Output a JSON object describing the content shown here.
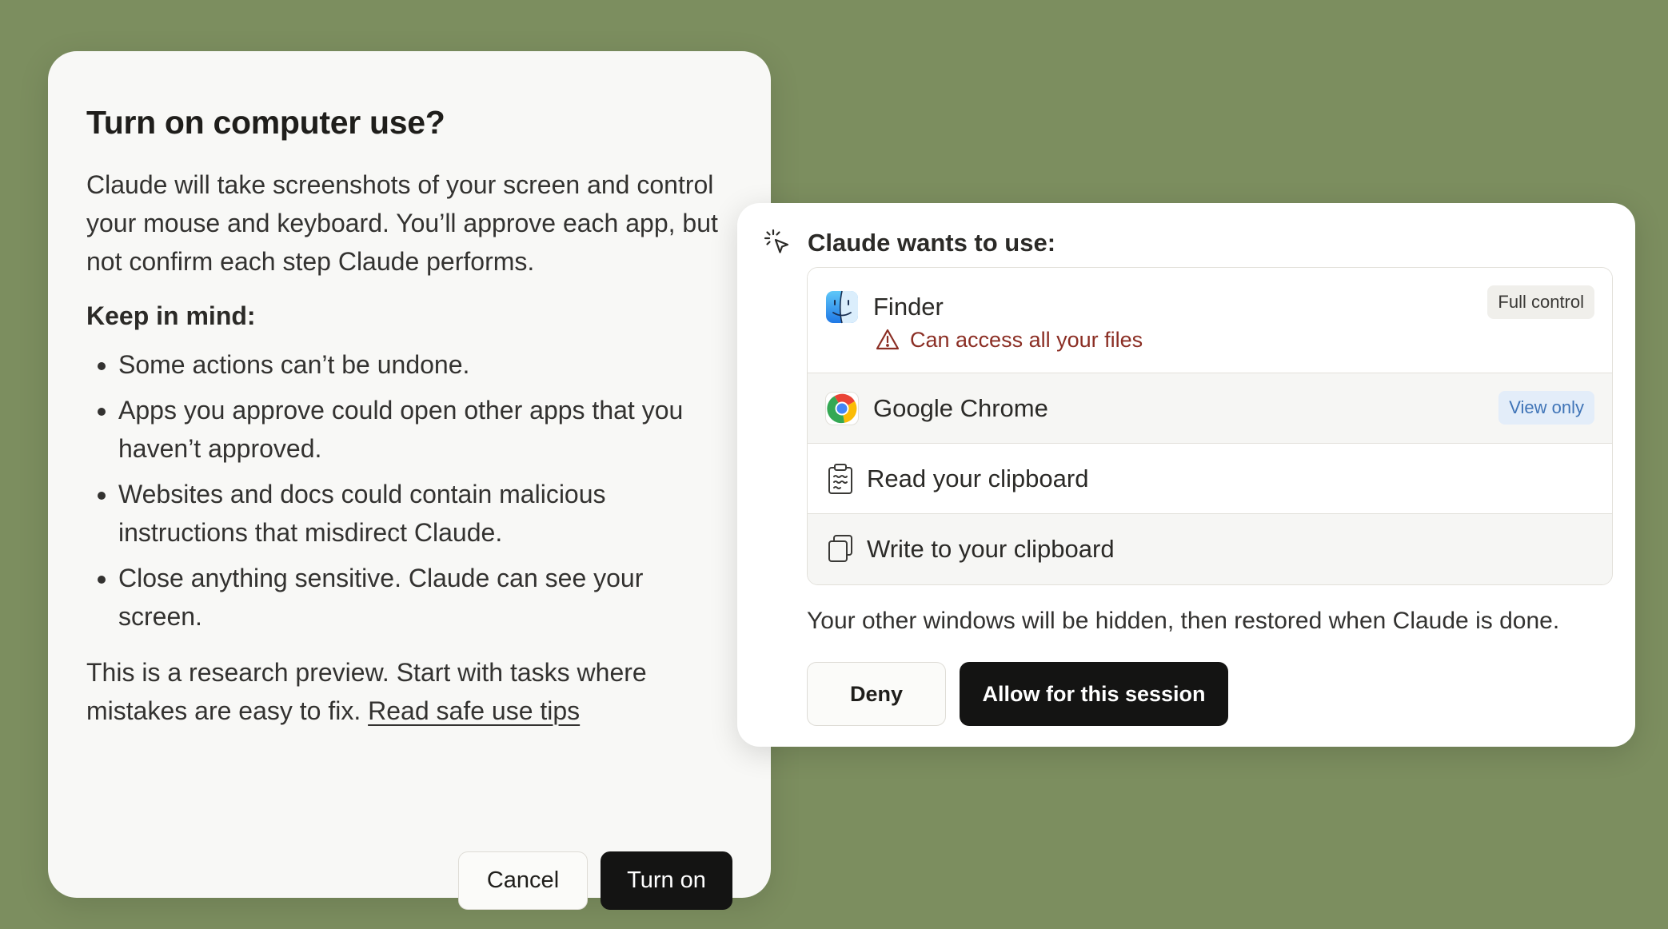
{
  "dialog": {
    "title": "Turn on computer use?",
    "intro": "Claude will take screenshots of your screen and control your mouse and keyboard. You’ll approve each app, but not confirm each step Claude performs.",
    "keep_in_mind_heading": "Keep in mind:",
    "bullets": [
      "Some actions can’t be undone.",
      "Apps you approve could open other apps that you haven’t approved.",
      "Websites and docs could contain malicious instructions that misdirect Claude.",
      "Close anything sensitive. Claude can see your screen."
    ],
    "note_text": "This is a research preview. Start with tasks where mistakes are easy to fix.",
    "note_link": "Read safe use tips",
    "cancel_label": "Cancel",
    "confirm_label": "Turn on"
  },
  "permission_panel": {
    "title": "Claude wants to use:",
    "items": [
      {
        "label": "Finder",
        "icon": "finder-icon",
        "tag": "Full control",
        "warning": "Can access all your files"
      },
      {
        "label": "Google Chrome",
        "icon": "chrome-icon",
        "tag": "View only"
      },
      {
        "label": "Read your clipboard",
        "icon": "clipboard-icon"
      },
      {
        "label": "Write to your clipboard",
        "icon": "copy-icon"
      }
    ],
    "note": "Your other windows will be hidden, then restored when Claude is done.",
    "deny_label": "Deny",
    "allow_label": "Allow for this session"
  },
  "colors": {
    "background": "#7c8e5f",
    "warning": "#8b2e24",
    "view_only_tag": "#3f74b7",
    "primary_button": "#141413"
  }
}
